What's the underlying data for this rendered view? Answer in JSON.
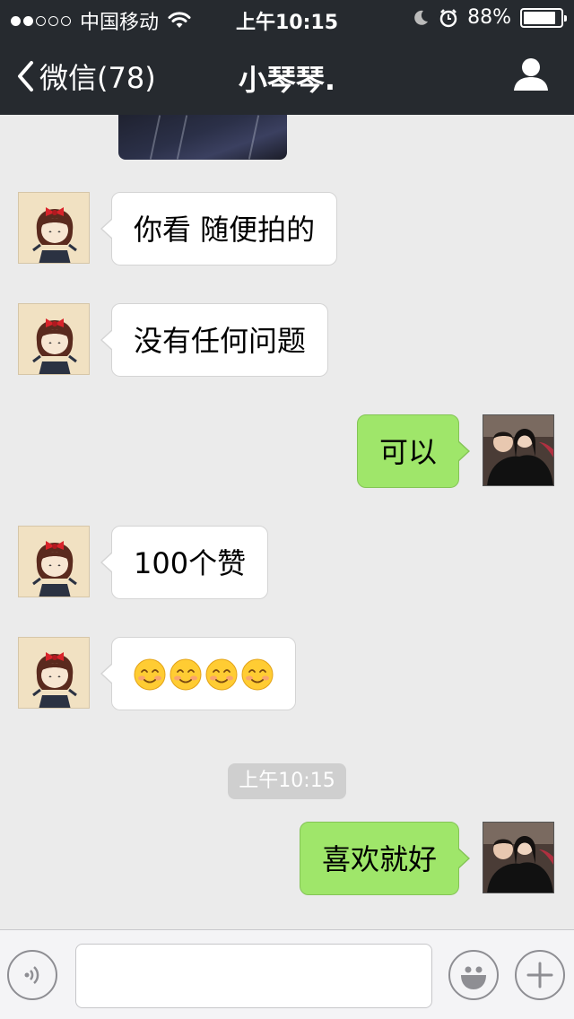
{
  "status_bar": {
    "carrier": "中国移动",
    "time": "上午10:15",
    "battery_percent": "88%",
    "battery_level": 0.88,
    "signal_bars": 2
  },
  "nav": {
    "back_label": "微信(78)",
    "title": "小琴琴."
  },
  "messages": [
    {
      "from": "her",
      "text": "你看 随便拍的"
    },
    {
      "from": "her",
      "text": "没有任何问题"
    },
    {
      "from": "me",
      "text": "可以"
    },
    {
      "from": "her",
      "text": "100个赞"
    },
    {
      "from": "her",
      "emoji": [
        "smiling-face-icon",
        "smiling-face-icon",
        "smiling-face-icon",
        "smiling-face-icon"
      ]
    },
    {
      "from": "me",
      "text": "喜欢就好"
    }
  ],
  "timestamp": "上午10:15",
  "input": {
    "value": "",
    "placeholder": ""
  },
  "colors": {
    "nav_bg": "#262a2f",
    "chat_bg": "#ebebeb",
    "outgoing_bubble": "#9fe66a",
    "incoming_bubble": "#ffffff"
  }
}
